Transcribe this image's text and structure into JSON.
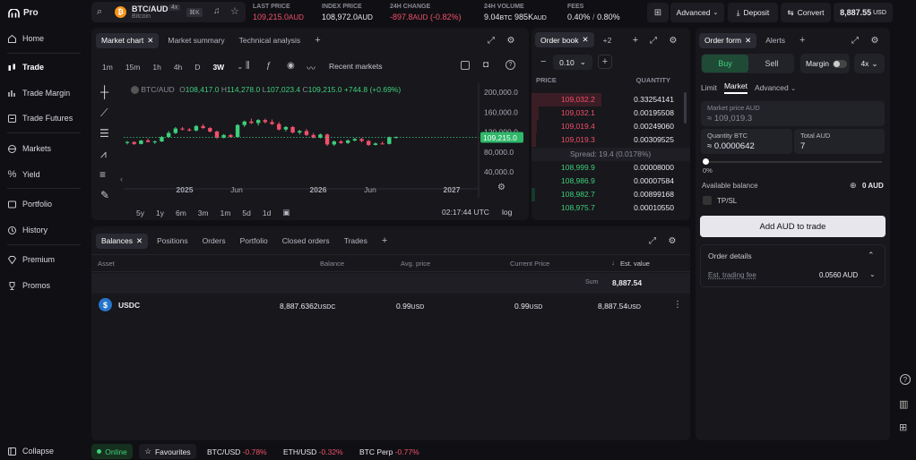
{
  "app": {
    "brand": "Pro"
  },
  "nav": {
    "items": [
      "Home",
      "Trade",
      "Trade Margin",
      "Trade Futures",
      "Markets",
      "Yield",
      "Portfolio",
      "History",
      "Premium",
      "Promos"
    ],
    "collapse": "Collapse"
  },
  "ticker": {
    "symbol": "BTC/AUD",
    "leverage": "4x",
    "name": "Bitcoin",
    "shortcut": "⌘K",
    "last_price_label": "LAST PRICE",
    "last_price": "109,215.0",
    "last_price_ccy": "AUD",
    "index_price_label": "INDEX PRICE",
    "index_price": "108,972.0",
    "index_price_ccy": "AUD",
    "change_label": "24H CHANGE",
    "change": "-897.8",
    "change_ccy": "AUD",
    "change_pct": "(-0.82%)",
    "volume_label": "24H VOLUME",
    "volume_btc": "9.04",
    "volume_btc_unit": "BTC",
    "volume_aud": "985K",
    "volume_aud_unit": "AUD",
    "fees_label": "FEES",
    "fees_maker": "0.40%",
    "fees_sep": "/",
    "fees_taker": "0.80%"
  },
  "top_actions": {
    "advanced": "Advanced",
    "deposit": "Deposit",
    "convert": "Convert",
    "balance": "8,887.55",
    "balance_ccy": "USD"
  },
  "chart_tabs": [
    "Market chart",
    "Market summary",
    "Technical analysis"
  ],
  "chart_toolbar": {
    "intervals": [
      "1m",
      "15m",
      "1h",
      "4h",
      "D",
      "3W"
    ],
    "recent": "Recent markets"
  },
  "chart_legend": {
    "symbol": "BTC/AUD",
    "o_label": "O",
    "o": "108,417.0",
    "h_label": "H",
    "h": "114,278.0",
    "l_label": "L",
    "l": "107,023.4",
    "c_label": "C",
    "c": "109,215.0",
    "chg": "+744.8 (+0.69%)"
  },
  "chart_footer": {
    "ranges": [
      "5y",
      "1y",
      "6m",
      "3m",
      "1m",
      "5d",
      "1d"
    ],
    "time": "02:17:44 UTC",
    "scale": "log"
  },
  "chart_data": {
    "type": "candlestick",
    "x_ticks": [
      "2025",
      "Jun",
      "2026",
      "Jun",
      "2027"
    ],
    "y_ticks": [
      "200,000.0",
      "160,000.0",
      "120,000.0",
      "80,000.0",
      "40,000.0"
    ],
    "ylim": [
      28000,
      220000
    ],
    "last_value_label": "109,215.0",
    "last_value": 109215,
    "candles": [
      [
        98,
        102,
        95,
        100
      ],
      [
        100,
        101,
        94,
        96
      ],
      [
        96,
        104,
        95,
        103
      ],
      [
        103,
        107,
        99,
        100
      ],
      [
        100,
        103,
        96,
        101
      ],
      [
        101,
        112,
        100,
        110
      ],
      [
        110,
        122,
        108,
        118
      ],
      [
        118,
        130,
        116,
        127
      ],
      [
        127,
        130,
        123,
        125
      ],
      [
        125,
        128,
        121,
        123
      ],
      [
        123,
        134,
        121,
        132
      ],
      [
        132,
        136,
        126,
        128
      ],
      [
        128,
        130,
        119,
        121
      ],
      [
        121,
        123,
        106,
        109
      ],
      [
        109,
        116,
        107,
        114
      ],
      [
        114,
        116,
        108,
        110
      ],
      [
        110,
        136,
        109,
        134
      ],
      [
        134,
        143,
        130,
        141
      ],
      [
        141,
        147,
        136,
        138
      ],
      [
        138,
        146,
        133,
        144
      ],
      [
        144,
        147,
        137,
        140
      ],
      [
        140,
        145,
        134,
        136
      ],
      [
        136,
        140,
        123,
        125
      ],
      [
        125,
        132,
        121,
        130
      ],
      [
        130,
        132,
        117,
        119
      ],
      [
        119,
        124,
        115,
        122
      ],
      [
        122,
        126,
        112,
        114
      ],
      [
        114,
        118,
        107,
        109
      ],
      [
        109,
        117,
        107,
        115
      ],
      [
        115,
        117,
        92,
        95
      ],
      [
        95,
        103,
        92,
        101
      ],
      [
        101,
        104,
        96,
        98
      ],
      [
        98,
        105,
        96,
        103
      ],
      [
        103,
        108,
        101,
        106
      ],
      [
        106,
        108,
        99,
        102
      ],
      [
        102,
        104,
        92,
        94
      ],
      [
        94,
        99,
        93,
        97
      ],
      [
        97,
        101,
        95,
        96
      ],
      [
        96,
        111,
        95,
        109
      ],
      [
        109,
        111,
        107,
        110
      ]
    ]
  },
  "order_book": {
    "tab": "Order book",
    "more": "+2",
    "tick": "0.10",
    "price_label": "PRICE",
    "qty_label": "QUANTITY",
    "asks": [
      {
        "p": "109,032.2",
        "q": "0.33254141"
      },
      {
        "p": "109,032.1",
        "q": "0.00195508"
      },
      {
        "p": "109,019.4",
        "q": "0.00249060"
      },
      {
        "p": "109,019.3",
        "q": "0.00309525"
      }
    ],
    "spread": "Spread: 19.4 (0.0178%)",
    "bids": [
      {
        "p": "108,999.9",
        "q": "0.00008000"
      },
      {
        "p": "108,986.9",
        "q": "0.00007584"
      },
      {
        "p": "108,982.7",
        "q": "0.00899168"
      },
      {
        "p": "108,975.7",
        "q": "0.00010550"
      }
    ]
  },
  "order_form": {
    "tabs": [
      "Order form",
      "Alerts"
    ],
    "buy": "Buy",
    "sell": "Sell",
    "margin": "Margin",
    "leverage": "4x",
    "types": [
      "Limit",
      "Market",
      "Advanced"
    ],
    "market_price_label": "Market price AUD",
    "market_price": "≈ 109,019.3",
    "qty_label": "Quantity BTC",
    "qty": "≈ 0.0000642",
    "total_label": "Total AUD",
    "total": "7",
    "slider_pct": "0%",
    "avail_label": "Available balance",
    "avail_value": "0",
    "avail_ccy": "AUD",
    "tpsl": "TP/SL",
    "cta": "Add AUD to trade",
    "details": "Order details",
    "fee_label": "Est. trading fee",
    "fee_value": "0.0560 AUD"
  },
  "balances": {
    "tabs": [
      "Balances",
      "Positions",
      "Orders",
      "Portfolio",
      "Closed orders",
      "Trades"
    ],
    "headers": [
      "Asset",
      "Balance",
      "Avg. price",
      "Current Price",
      "Est. value"
    ],
    "sum_label": "Sum",
    "sum_value": "8,887.54",
    "rows": [
      {
        "asset": "USDC",
        "balance": "8,887.6362",
        "balance_ccy": "USDC",
        "avg": "0.99",
        "avg_ccy": "USD",
        "cur": "0.99",
        "cur_ccy": "USD",
        "est": "8,887.54",
        "est_ccy": "USD"
      }
    ]
  },
  "bottom": {
    "online": "Online",
    "favourites": "Favourites",
    "tickers": [
      {
        "s": "BTC/USD",
        "c": "-0.78%"
      },
      {
        "s": "ETH/USD",
        "c": "-0.32%"
      },
      {
        "s": "BTC Perp",
        "c": "-0.77%"
      }
    ]
  },
  "colors": {
    "bg": "#101014",
    "panel": "#17171c",
    "green": "#3fcf7b",
    "red": "#f0506a",
    "accent": "#7b61ff"
  }
}
